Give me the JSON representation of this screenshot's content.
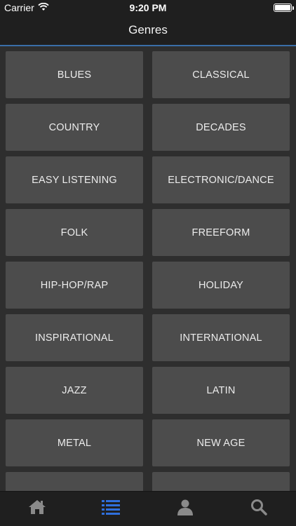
{
  "status_bar": {
    "carrier": "Carrier",
    "time": "9:20 PM"
  },
  "nav": {
    "title": "Genres"
  },
  "genres": [
    "BLUES",
    "CLASSICAL",
    "COUNTRY",
    "DECADES",
    "EASY LISTENING",
    "ELECTRONIC/DANCE",
    "FOLK",
    "FREEFORM",
    "HIP-HOP/RAP",
    "HOLIDAY",
    "INSPIRATIONAL",
    "INTERNATIONAL",
    "JAZZ",
    "LATIN",
    "METAL",
    "NEW AGE",
    "",
    ""
  ],
  "tabs": [
    {
      "icon": "home-icon",
      "active": false
    },
    {
      "icon": "list-icon",
      "active": true
    },
    {
      "icon": "profile-icon",
      "active": false
    },
    {
      "icon": "search-icon",
      "active": false
    }
  ],
  "colors": {
    "active_tab": "#2f6fdc",
    "inactive_tab": "#8a8a8a",
    "accent_line": "#3a6ea8"
  }
}
